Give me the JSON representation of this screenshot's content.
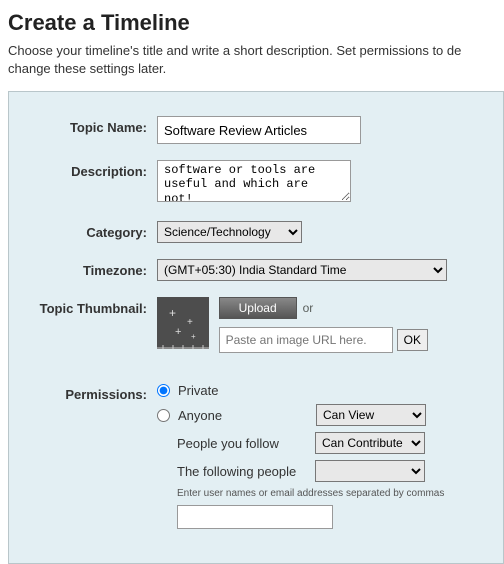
{
  "title": "Create a Timeline",
  "description": "Choose your timeline's title and write a short description. Set permissions to de change these settings later.",
  "labels": {
    "topicName": "Topic Name:",
    "description": "Description:",
    "category": "Category:",
    "timezone": "Timezone:",
    "thumbnail": "Topic Thumbnail:",
    "permissions": "Permissions:"
  },
  "fields": {
    "topicName": "Software Review Articles",
    "descriptionText": "software or tools are useful and which are not!",
    "categorySelected": "Science/Technology",
    "timezoneSelected": "(GMT+05:30) India Standard Time",
    "uploadLabel": "Upload",
    "orText": "or",
    "urlPlaceholder": "Paste an image URL here.",
    "okLabel": "OK"
  },
  "permissions": {
    "private": "Private",
    "anyone": "Anyone",
    "peopleFollow": "People you follow",
    "followingPeople": "The following people",
    "hint": "Enter user names or email addresses separated by commas",
    "canView": "Can View",
    "canContribute": "Can Contribute"
  }
}
